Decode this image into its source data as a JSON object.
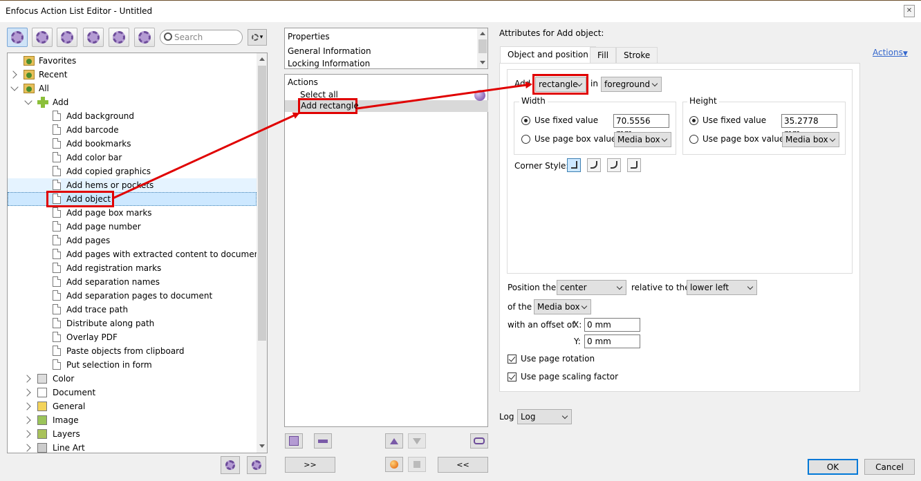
{
  "window": {
    "title": "Enfocus Action List Editor - Untitled",
    "close_glyph": "✕"
  },
  "toolbar": {
    "icons": [
      "all-actions-icon",
      "favorite-actions-icon",
      "recent-actions-icon",
      "approved-actions-icon",
      "info-actions-icon",
      "tools-actions-icon"
    ],
    "search_placeholder": "Search",
    "settings_glyph": "▾"
  },
  "tree": {
    "top": [
      {
        "label": "Favorites",
        "icon": "folder-icon",
        "expander": "none"
      },
      {
        "label": "Recent",
        "icon": "folder-icon",
        "expander": "closed"
      },
      {
        "label": "All",
        "icon": "folder-icon",
        "expander": "open"
      }
    ],
    "add_group": {
      "label": "Add",
      "icon": "plus-icon"
    },
    "add_items": [
      "Add background",
      "Add barcode",
      "Add bookmarks",
      "Add color bar",
      "Add copied graphics",
      "Add hems or pockets",
      "Add object",
      "Add page box marks",
      "Add page number",
      "Add pages",
      "Add pages with extracted content to document",
      "Add registration marks",
      "Add separation names",
      "Add separation pages to document",
      "Add trace path",
      "Distribute along path",
      "Overlay PDF",
      "Paste objects from clipboard",
      "Put selection in form"
    ],
    "selected_item": "Add object",
    "hovered_item": "Add hems or pockets",
    "categories": [
      "Color",
      "Document",
      "General",
      "Image",
      "Layers",
      "Line Art"
    ]
  },
  "properties": {
    "items": [
      "Properties",
      "General Information",
      "Locking Information"
    ]
  },
  "actions_list": {
    "items": [
      "Actions",
      "Select all",
      "Add rectangle"
    ],
    "selected": "Add rectangle"
  },
  "buttons": {
    "add_forward": ">>",
    "remove_back": "<<",
    "ok": "OK",
    "cancel": "Cancel"
  },
  "attributes": {
    "heading": "Attributes for Add object:",
    "actions_link": "Actions",
    "tabs": [
      "Object and position",
      "Fill",
      "Stroke"
    ],
    "active_tab": "Object and position",
    "add_label": "Add",
    "object_type": "rectangle",
    "in_label": "in",
    "layer": "foreground",
    "width": {
      "title": "Width",
      "fixed_label": "Use fixed value",
      "fixed_value": "70.5556 mm",
      "pagebox_label": "Use page box value",
      "pagebox_value": "Media box",
      "selected": "fixed"
    },
    "height": {
      "title": "Height",
      "fixed_label": "Use fixed value",
      "fixed_value": "35.2778 mm",
      "pagebox_label": "Use page box value",
      "pagebox_value": "Media box",
      "selected": "fixed"
    },
    "corner_style_label": "Corner Style:",
    "corner_styles": [
      "square-corner-icon",
      "rounded-corner-icon",
      "inverted-round-corner-icon",
      "beveled-corner-icon"
    ],
    "position_label": "Position the",
    "position_anchor": "center",
    "relative_label": "relative to the",
    "relative_anchor": "lower left",
    "of_the_label": "of the",
    "box": "Media box",
    "offset_label": "with an offset of",
    "x_label": "X:",
    "x_value": "0 mm",
    "y_label": "Y:",
    "y_value": "0 mm",
    "use_page_rotation": "Use page rotation",
    "use_page_rotation_checked": true,
    "use_page_scaling": "Use page scaling factor",
    "use_page_scaling_checked": true
  },
  "log": {
    "label": "Log",
    "value": "Log"
  },
  "colors": {
    "highlight_red": "#e00000",
    "selection_blue": "#cde8ff",
    "link_blue": "#3366cc"
  }
}
